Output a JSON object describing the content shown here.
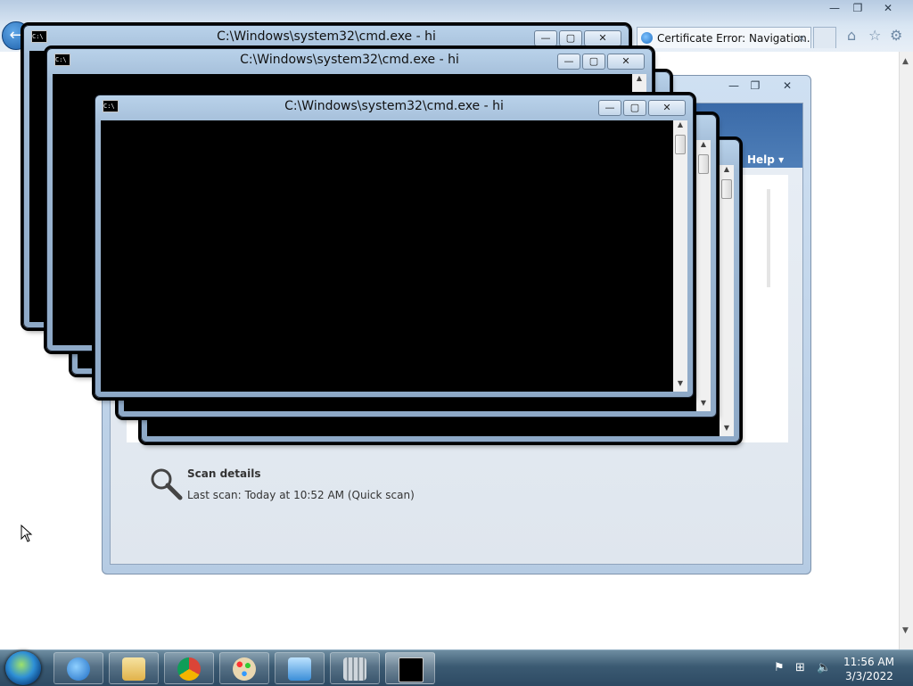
{
  "browser": {
    "tab_title": "Certificate Error: Navigation...",
    "tab_close": "×",
    "back": "←",
    "home_icon": "home-icon",
    "favorites_icon": "star-icon",
    "tools_icon": "gear-icon",
    "window_controls": {
      "minimize": "—",
      "restore": "❐",
      "close": "✕"
    }
  },
  "app_window": {
    "controls": {
      "minimize": "—",
      "restore": "❐",
      "close": "✕"
    },
    "help_label": "Help ▾",
    "scan": {
      "title": "Scan details",
      "last_scan_label": "Last scan:",
      "last_scan_value": "Today at 10:52 AM (Quick scan)"
    }
  },
  "cmd_windows": [
    {
      "title": "C:\\Windows\\system32\\cmd.exe - hi"
    },
    {
      "title": "C:\\Windows\\system32\\cmd.exe - hi"
    },
    {
      "title": "C:\\Windows\\system32\\cmd.exe - hi"
    }
  ],
  "cmd_controls": {
    "minimize": "—",
    "maximize": "▢",
    "close": "✕",
    "sys_icon": "C:\\"
  },
  "taskbar": {
    "pinned": [
      "internet-explorer",
      "file-explorer",
      "chrome",
      "paint",
      "control-panel",
      "app",
      "cmd"
    ],
    "clock_time": "11:56 AM",
    "clock_date": "3/3/2022"
  },
  "colors": {
    "console_bg": "#000000",
    "taskbar": "#3b5a72",
    "accent": "#2e8fd6"
  }
}
